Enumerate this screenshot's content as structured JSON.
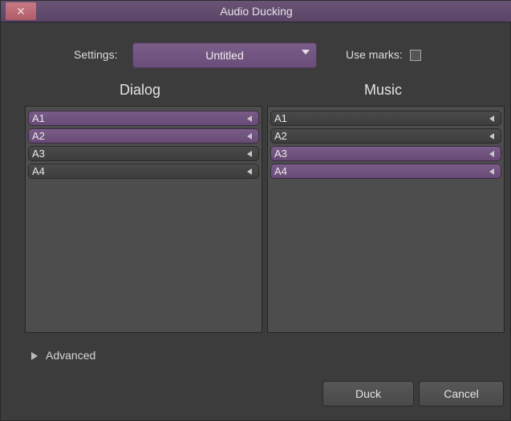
{
  "window": {
    "title": "Audio Ducking",
    "close_glyph": "✕"
  },
  "settings": {
    "label": "Settings:",
    "value": "Untitled",
    "use_marks_label": "Use marks:",
    "use_marks_checked": false
  },
  "dialog": {
    "title": "Dialog",
    "tracks": [
      {
        "name": "A1",
        "selected": true
      },
      {
        "name": "A2",
        "selected": true
      },
      {
        "name": "A3",
        "selected": false
      },
      {
        "name": "A4",
        "selected": false
      }
    ]
  },
  "music": {
    "title": "Music",
    "tracks": [
      {
        "name": "A1",
        "selected": false
      },
      {
        "name": "A2",
        "selected": false
      },
      {
        "name": "A3",
        "selected": true
      },
      {
        "name": "A4",
        "selected": true
      }
    ]
  },
  "advanced": {
    "label": "Advanced"
  },
  "buttons": {
    "duck": "Duck",
    "cancel": "Cancel"
  },
  "colors": {
    "accent": "#6f5280",
    "background": "#3c3c3c",
    "panel": "#4d4d4d"
  }
}
